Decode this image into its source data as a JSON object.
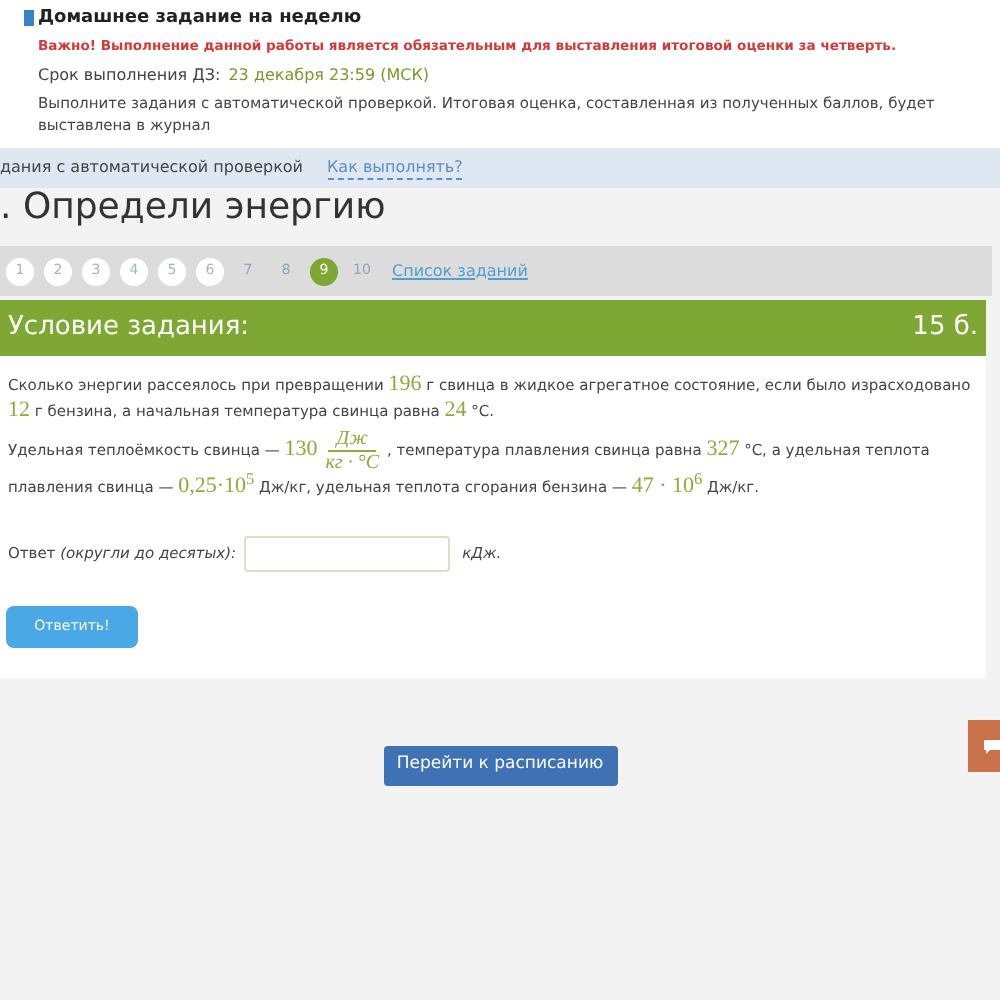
{
  "notice": {
    "title": "Домашнее задание на неделю",
    "warning": "Важно! Выполнение данной работы является обязательным для выставления итоговой оценки за четверть.",
    "deadline_label": "Срок выполнения ДЗ:",
    "deadline": "23 декабря 23:59 (МСК)",
    "description": "Выполните задания с автоматической проверкой. Итоговая оценка, составленная из полученных баллов, будет выставлена в журнал"
  },
  "info_bar": {
    "text": "дания с автоматической проверкой",
    "link": "Как выполнять?"
  },
  "task_title": ". Определи энергию",
  "pagination": {
    "items": [
      {
        "label": "1",
        "selected": false,
        "visited": true
      },
      {
        "label": "2",
        "selected": false,
        "visited": true
      },
      {
        "label": "3",
        "selected": false,
        "visited": true
      },
      {
        "label": "4",
        "selected": false,
        "visited": true
      },
      {
        "label": "5",
        "selected": false,
        "visited": true
      },
      {
        "label": "6",
        "selected": false,
        "visited": true
      },
      {
        "label": "7",
        "selected": false,
        "visited": false
      },
      {
        "label": "8",
        "selected": false,
        "visited": false
      },
      {
        "label": "9",
        "selected": true,
        "visited": true
      },
      {
        "label": "10",
        "selected": false,
        "visited": false
      }
    ],
    "list_link": "Список заданий"
  },
  "task": {
    "header": "Условие задания:",
    "points": "15 б.",
    "paragraphs": [
      [
        {
          "kind": "text",
          "text": "Сколько энергии рассеялось при превращении "
        },
        {
          "kind": "value",
          "text": "196"
        },
        {
          "kind": "text",
          "text": " г свинца в жидкое агрегатное состояние, если было израсходовано "
        },
        {
          "kind": "value",
          "text": "12"
        },
        {
          "kind": "text",
          "text": " г бензина, а начальная температура свинца равна "
        },
        {
          "kind": "value",
          "text": "24"
        },
        {
          "kind": "text",
          "text": " °С."
        }
      ],
      [
        {
          "kind": "text",
          "text": "Удельная теплоёмкость свинца — "
        },
        {
          "kind": "value",
          "text": "130"
        },
        {
          "kind": "fraction",
          "numerator": "Дж",
          "denominator": "кг · °С"
        },
        {
          "kind": "text",
          "text": ", температура плавления свинца равна "
        },
        {
          "kind": "value",
          "text": "327"
        },
        {
          "kind": "text",
          "text": " °С, а удельная теплота плавления свинца — "
        },
        {
          "kind": "value",
          "text": "0,25·10$^{5}$"
        },
        {
          "kind": "text",
          "text": " Дж/кг, удельная теплота сгорания бензина — "
        },
        {
          "kind": "value",
          "text": "47 · 10$^{6}$"
        },
        {
          "kind": "text",
          "text": " Дж/кг."
        }
      ]
    ],
    "answer_label": "Ответ ",
    "answer_hint": "(округли до десятых):",
    "unit": "кДж.",
    "submit": "Ответить!"
  },
  "schedule_button": "Перейти к расписанию"
}
